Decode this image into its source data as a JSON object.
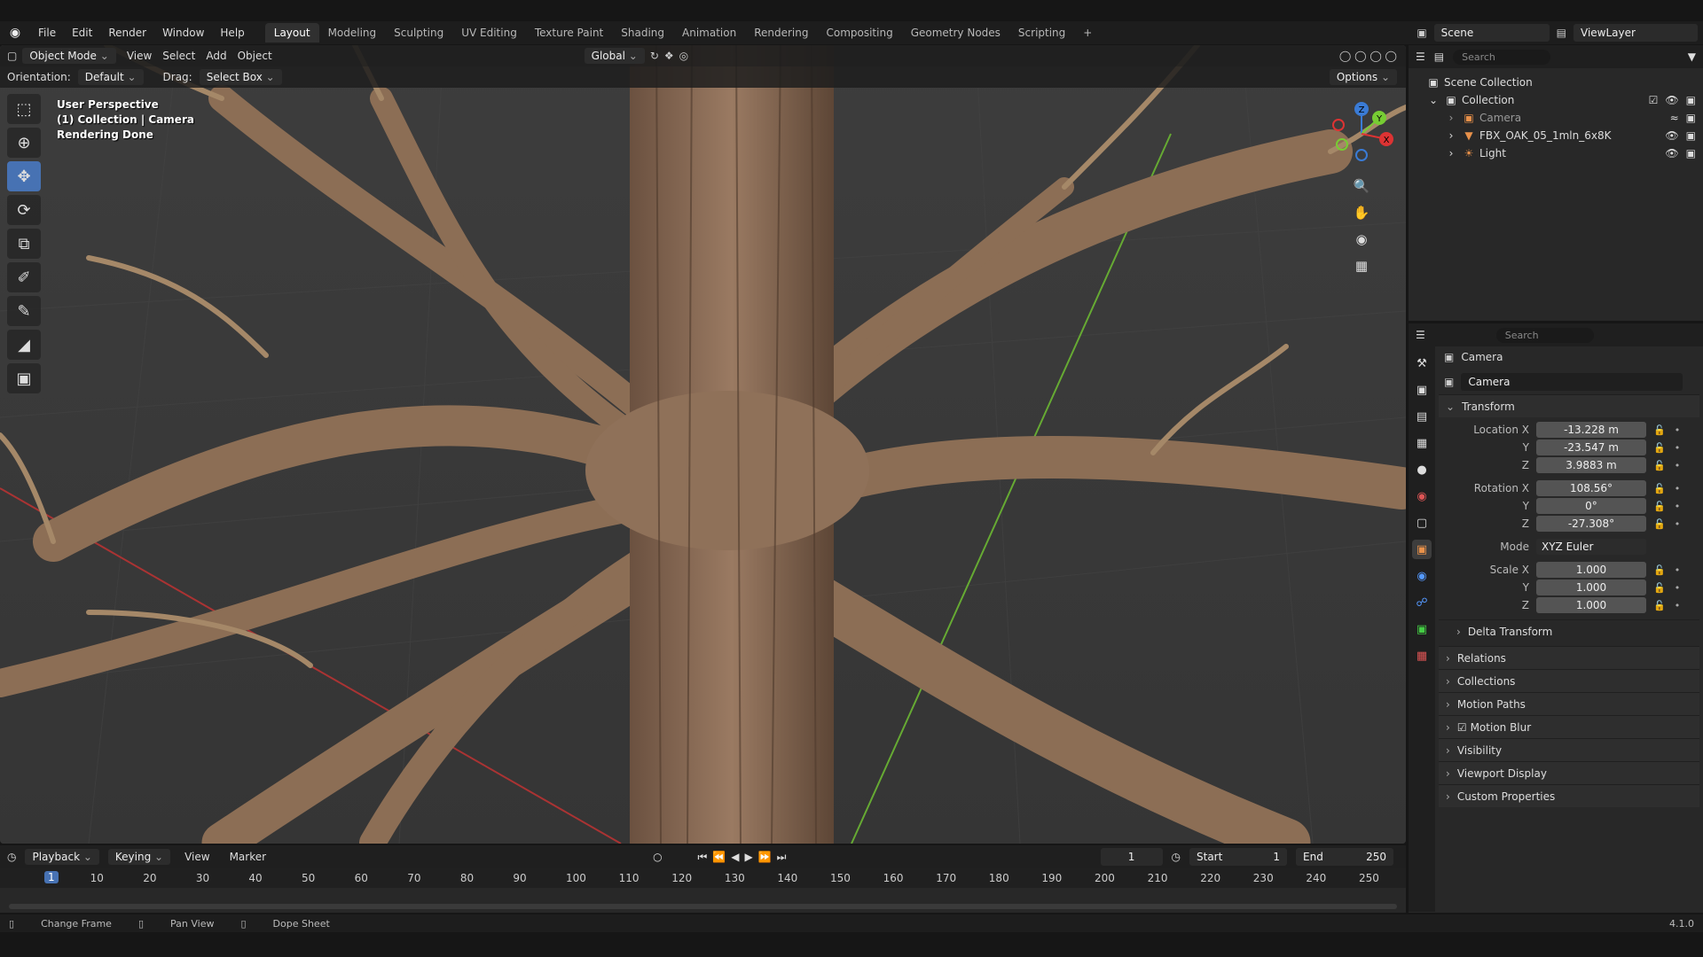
{
  "menu": [
    "File",
    "Edit",
    "Render",
    "Window",
    "Help"
  ],
  "workspaces": [
    "Layout",
    "Modeling",
    "Sculpting",
    "UV Editing",
    "Texture Paint",
    "Shading",
    "Animation",
    "Rendering",
    "Compositing",
    "Geometry Nodes",
    "Scripting"
  ],
  "active_workspace": "Layout",
  "header_right": {
    "scene": "Scene",
    "view_layer": "ViewLayer"
  },
  "viewport": {
    "mode": "Object Mode",
    "menus": [
      "View",
      "Select",
      "Add",
      "Object"
    ],
    "transform": "Global",
    "orientation_label": "Orientation:",
    "orientation_value": "Default",
    "drag_label": "Drag:",
    "drag_value": "Select Box",
    "options": "Options",
    "overlay_lines": [
      "User Perspective",
      "(1) Collection | Camera",
      "Rendering Done"
    ],
    "axes": {
      "x": "X",
      "y": "Y",
      "z": "Z"
    }
  },
  "outliner": {
    "search_placeholder": "Search",
    "rows": [
      {
        "label": "Scene Collection",
        "icon": "scene-collection-icon"
      },
      {
        "label": "Collection",
        "icon": "collection-icon"
      },
      {
        "label": "Camera",
        "icon": "camera-icon"
      },
      {
        "label": "FBX_OAK_05_1mln_6x8K",
        "icon": "mesh-icon"
      },
      {
        "label": "Light",
        "icon": "light-icon"
      }
    ]
  },
  "properties": {
    "search_placeholder": "Search",
    "object_name": "Camera",
    "object_field": "Camera",
    "transform_label": "Transform",
    "location": {
      "label": "Location X",
      "x": "-13.228 m",
      "y": "-23.547 m",
      "z": "3.9883 m"
    },
    "rotation": {
      "label": "Rotation X",
      "x": "108.56°",
      "y": "0°",
      "z": "-27.308°"
    },
    "mode_label": "Mode",
    "mode_value": "XYZ Euler",
    "scale": {
      "label": "Scale X",
      "x": "1.000",
      "y": "1.000",
      "z": "1.000"
    },
    "y_label": "Y",
    "z_label": "Z",
    "panels": [
      "Delta Transform",
      "Relations",
      "Collections",
      "Motion Paths",
      "Motion Blur",
      "Visibility",
      "Viewport Display",
      "Custom Properties"
    ]
  },
  "timeline": {
    "menus": [
      "Playback",
      "Keying",
      "View",
      "Marker"
    ],
    "current_frame": "1",
    "start_label": "Start",
    "start": "1",
    "end_label": "End",
    "end": "250",
    "ticks": [
      "10",
      "20",
      "30",
      "40",
      "50",
      "60",
      "70",
      "80",
      "90",
      "100",
      "110",
      "120",
      "130",
      "140",
      "150",
      "160",
      "170",
      "180",
      "190",
      "200",
      "210",
      "220",
      "230",
      "240",
      "250"
    ]
  },
  "statusbar": {
    "items": [
      "Change Frame",
      "Pan View",
      "Dope Sheet"
    ],
    "version": "4.1.0"
  }
}
